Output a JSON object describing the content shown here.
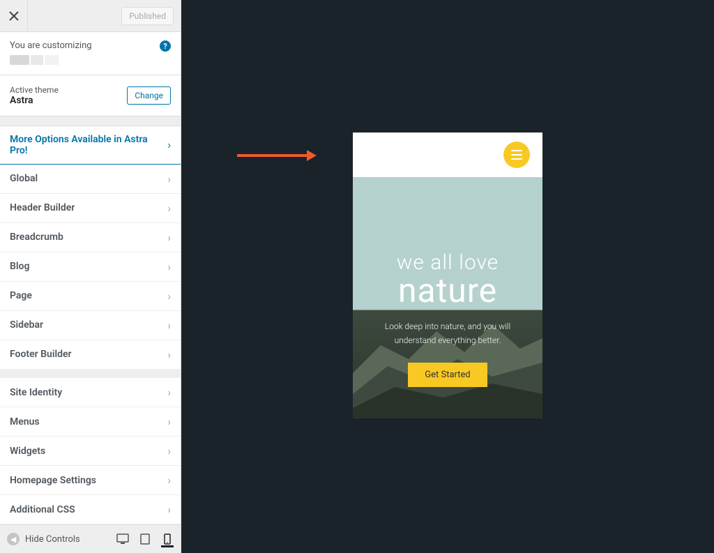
{
  "header": {
    "publish_label": "Published"
  },
  "customizing": {
    "label": "You are customizing"
  },
  "theme": {
    "label": "Active theme",
    "name": "Astra",
    "change_label": "Change"
  },
  "promo": {
    "label": "More Options Available in Astra Pro!"
  },
  "panels_a": [
    {
      "label": "Global"
    },
    {
      "label": "Header Builder"
    },
    {
      "label": "Breadcrumb"
    },
    {
      "label": "Blog"
    },
    {
      "label": "Page"
    },
    {
      "label": "Sidebar"
    },
    {
      "label": "Footer Builder"
    }
  ],
  "panels_b": [
    {
      "label": "Site Identity"
    },
    {
      "label": "Menus"
    },
    {
      "label": "Widgets"
    },
    {
      "label": "Homepage Settings"
    },
    {
      "label": "Additional CSS"
    }
  ],
  "footer": {
    "hide_label": "Hide Controls"
  },
  "preview": {
    "line1": "we all love",
    "line2": "nature",
    "subtitle": "Look deep into nature, and you will understand everything better.",
    "cta": "Get Started"
  }
}
